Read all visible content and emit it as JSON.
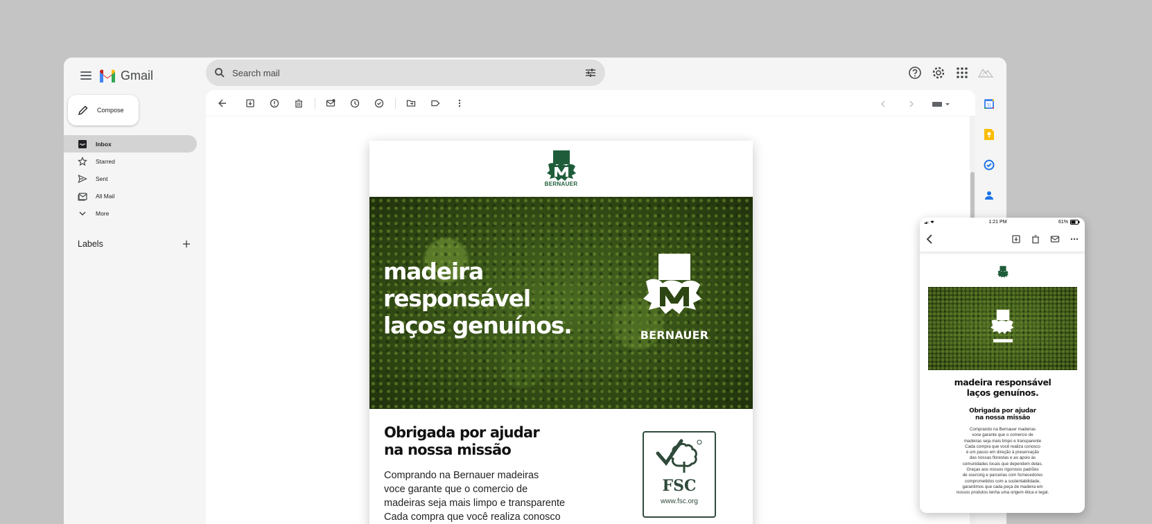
{
  "app": {
    "name": "Gmail"
  },
  "search": {
    "placeholder": "Search mail"
  },
  "sidebar": {
    "compose_label": "Compose",
    "items": [
      {
        "label": "Inbox",
        "icon": "inbox-icon",
        "active": true
      },
      {
        "label": "Starred",
        "icon": "star-icon"
      },
      {
        "label": "Sent",
        "icon": "send-icon"
      },
      {
        "label": "All Mail",
        "icon": "all-mail-icon"
      },
      {
        "label": "More",
        "icon": "chevron-down-icon"
      }
    ],
    "labels_title": "Labels"
  },
  "email": {
    "brand": "BERNAUER",
    "hero_line1": "madeira",
    "hero_line2": "responsável",
    "hero_line3": "laços genuínos.",
    "heading_line1": "Obrigada por ajudar",
    "heading_line2": "na nossa missão",
    "body_line1": "Comprando na Bernauer madeiras",
    "body_line2": "voce garante que o comercio de",
    "body_line3": "madeiras seja mais limpo e transparente",
    "body_line4": "Cada compra que você realiza conosco",
    "fsc_label": "FSC",
    "fsc_url": "www.fsc.org"
  },
  "phone": {
    "time": "1:21 PM",
    "battery": "61%",
    "hero_title_line1": "madeira responsável",
    "hero_title_line2": "laços genuínos.",
    "heading_line1": "Obrigada por ajudar",
    "heading_line2": "na nossa missão",
    "body": [
      "Comprando na Bernauer madeiras",
      "voce garante que o comercio de",
      "madeiras seja mais limpo e transparente",
      "Cada compra que você realiza conosco",
      "é um passo em direção à preservação",
      "das nossas florestas e ao apoio às",
      "comunidades locais que dependem delas.",
      "Graças aos nossos rigorosos padrões",
      "de sourcing e parcerias com fornecedores",
      "comprometidos com a sustentabilidade,",
      "garantimos que cada peça de madeira em",
      "nossos produtos tenha uma origem ética e legal."
    ]
  },
  "colors": {
    "accent_red": "#ea4335",
    "accent_blue": "#1a73e8",
    "forest_green": "#2f4a3a",
    "brand_green": "#1f5d3a"
  }
}
